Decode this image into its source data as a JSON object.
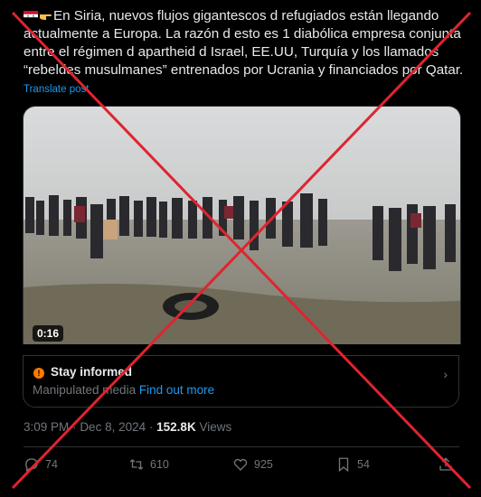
{
  "post": {
    "text": "En Siria, nuevos flujos gigantescos d refugiados están llegando actualmente a Europa. La razón d esto es 1 diabólica empresa conjunta entre el régimen d apartheid d Israel, EE.UU, Turquía y los llamados “rebeldes musulmanes” entrenados por Ucrania y financiados por Qatar.",
    "translate_label": "Translate post"
  },
  "media": {
    "duration": "0:16"
  },
  "note": {
    "title": "Stay informed",
    "subtitle": "Manipulated media",
    "link": "Find out more"
  },
  "meta": {
    "time": "3:09 PM",
    "separator": "·",
    "date": "Dec 8, 2024",
    "dot": "·",
    "views_count": "152.8K",
    "views_label": "Views"
  },
  "actions": {
    "replies": "74",
    "reposts": "610",
    "likes": "925",
    "bookmarks": "54"
  },
  "colors": {
    "background": "#000000",
    "text": "#e7e9ea",
    "muted": "#71767b",
    "link": "#1d9bf0",
    "overlay_x": "#e0242f"
  }
}
